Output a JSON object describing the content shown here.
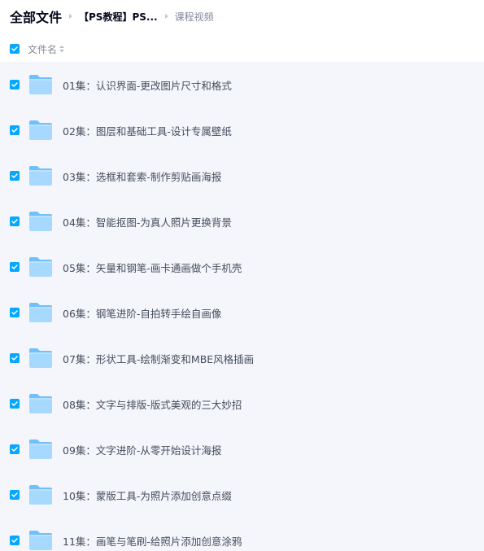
{
  "breadcrumb": {
    "root": "全部文件",
    "parent": "【PS教程】PS...",
    "current": "课程视频"
  },
  "header": {
    "column_name": "文件名",
    "select_all_checked": true,
    "sort_icon": "sort-icon"
  },
  "colors": {
    "accent": "#06a7ff",
    "list_background": "#f5f6fc",
    "folder_light": "#a6d9fd",
    "folder_dark": "#6fc0fb"
  },
  "files": [
    {
      "name": "01集：认识界面-更改图片尺寸和格式",
      "checked": true,
      "icon": "folder-icon"
    },
    {
      "name": "02集：图层和基础工具-设计专属壁纸",
      "checked": true,
      "icon": "folder-icon"
    },
    {
      "name": "03集：选框和套索-制作剪贴画海报",
      "checked": true,
      "icon": "folder-icon"
    },
    {
      "name": "04集：智能抠图-为真人照片更换背景",
      "checked": true,
      "icon": "folder-icon"
    },
    {
      "name": "05集：矢量和钢笔-画卡通画做个手机壳",
      "checked": true,
      "icon": "folder-icon"
    },
    {
      "name": "06集：钢笔进阶-自拍转手绘自画像",
      "checked": true,
      "icon": "folder-icon"
    },
    {
      "name": "07集：形状工具-绘制渐变和MBE风格插画",
      "checked": true,
      "icon": "folder-icon"
    },
    {
      "name": "08集：文字与排版-版式美观的三大妙招",
      "checked": true,
      "icon": "folder-icon"
    },
    {
      "name": "09集：文字进阶-从零开始设计海报",
      "checked": true,
      "icon": "folder-icon"
    },
    {
      "name": "10集：蒙版工具-为照片添加创意点缀",
      "checked": true,
      "icon": "folder-icon"
    },
    {
      "name": "11集：画笔与笔刷-给照片添加创意涂鸦",
      "checked": true,
      "icon": "folder-icon"
    }
  ]
}
